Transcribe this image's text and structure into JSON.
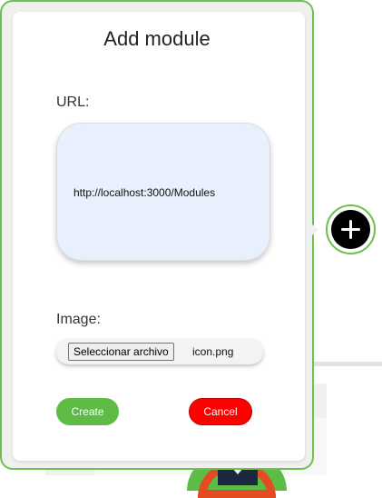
{
  "modal": {
    "title": "Add module",
    "url_label": "URL:",
    "url_value": "http://localhost:3000/Modules",
    "image_label": "Image:",
    "file_button_label": "Seleccionar archivo",
    "file_name": "icon.png",
    "create_label": "Create",
    "cancel_label": "Cancel"
  },
  "add_button": {
    "icon": "plus-icon"
  },
  "colors": {
    "accent_green": "#6cc24a",
    "create_green": "#5dbb46",
    "cancel_red": "#ff0000",
    "url_box_bg": "#e8f0fe"
  }
}
